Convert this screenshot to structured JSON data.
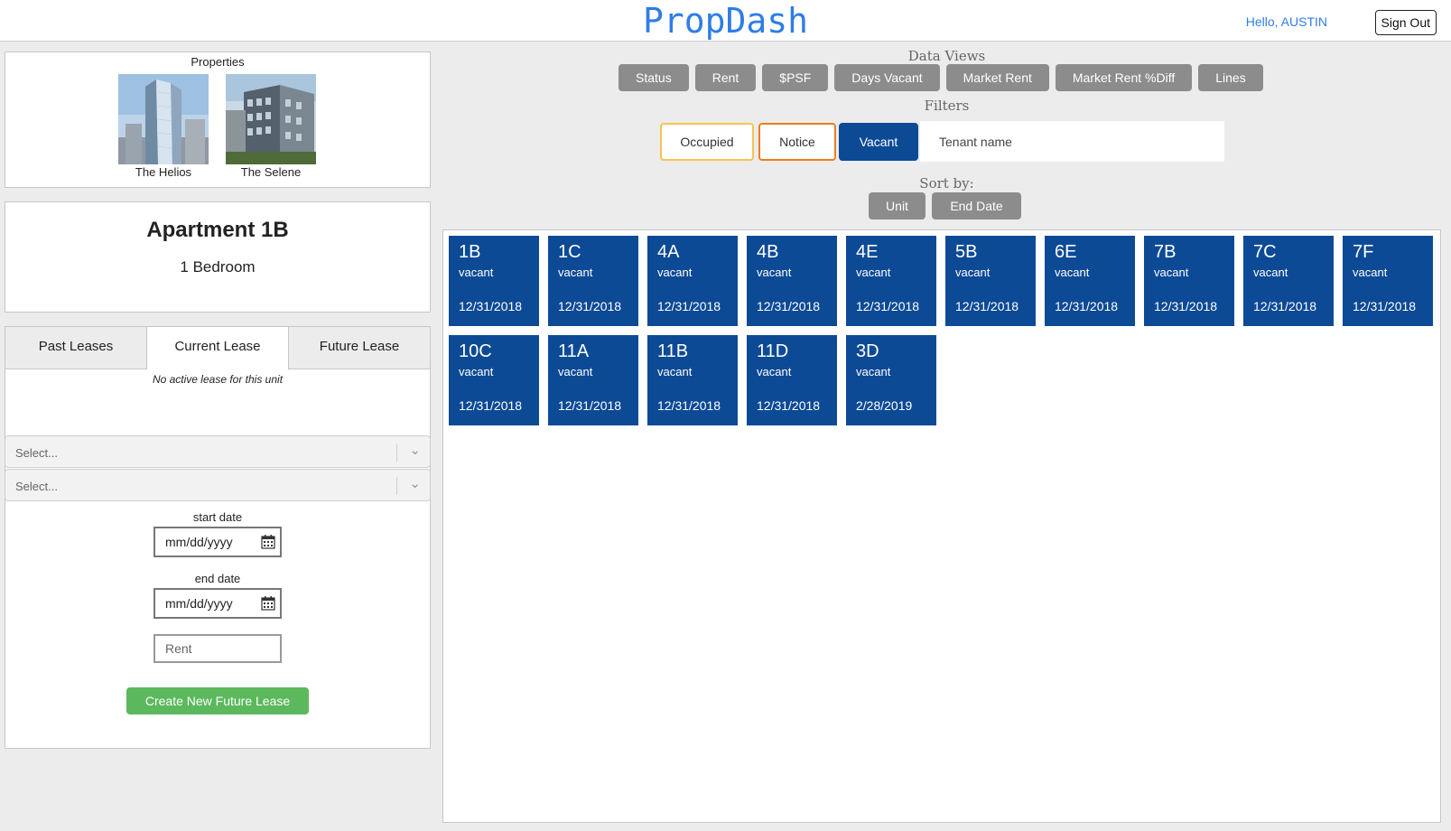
{
  "header": {
    "logo": "PropDash",
    "greeting": "Hello, AUSTIN",
    "signout_label": "Sign Out"
  },
  "properties": {
    "title": "Properties",
    "items": [
      {
        "name": "The Helios"
      },
      {
        "name": "The Selene"
      }
    ]
  },
  "apartment": {
    "title": "Apartment 1B",
    "subtitle": "1 Bedroom"
  },
  "lease": {
    "tabs": [
      {
        "label": "Past Leases"
      },
      {
        "label": "Current Lease",
        "active": true
      },
      {
        "label": "Future Lease"
      }
    ],
    "no_active_message": "No active lease for this unit",
    "select1_placeholder": "Select...",
    "select2_placeholder": "Select...",
    "start_label": "start date",
    "start_placeholder": "mm/dd/yyyy",
    "end_label": "end date",
    "end_placeholder": "mm/dd/yyyy",
    "rent_placeholder": "Rent",
    "create_label": "Create New Future Lease"
  },
  "data_views": {
    "title": "Data Views",
    "buttons": [
      "Status",
      "Rent",
      "$PSF",
      "Days Vacant",
      "Market Rent",
      "Market Rent %Diff",
      "Lines"
    ]
  },
  "filters": {
    "title": "Filters",
    "occupied_label": "Occupied",
    "notice_label": "Notice",
    "vacant_label": "Vacant",
    "tenant_placeholder": "Tenant name"
  },
  "sort": {
    "title": "Sort by:",
    "buttons": [
      "Unit",
      "End Date"
    ]
  },
  "units": [
    {
      "unit": "1B",
      "status": "vacant",
      "date": "12/31/2018"
    },
    {
      "unit": "1C",
      "status": "vacant",
      "date": "12/31/2018"
    },
    {
      "unit": "4A",
      "status": "vacant",
      "date": "12/31/2018"
    },
    {
      "unit": "4B",
      "status": "vacant",
      "date": "12/31/2018"
    },
    {
      "unit": "4E",
      "status": "vacant",
      "date": "12/31/2018"
    },
    {
      "unit": "5B",
      "status": "vacant",
      "date": "12/31/2018"
    },
    {
      "unit": "6E",
      "status": "vacant",
      "date": "12/31/2018"
    },
    {
      "unit": "7B",
      "status": "vacant",
      "date": "12/31/2018"
    },
    {
      "unit": "7C",
      "status": "vacant",
      "date": "12/31/2018"
    },
    {
      "unit": "7F",
      "status": "vacant",
      "date": "12/31/2018"
    },
    {
      "unit": "10C",
      "status": "vacant",
      "date": "12/31/2018"
    },
    {
      "unit": "11A",
      "status": "vacant",
      "date": "12/31/2018"
    },
    {
      "unit": "11B",
      "status": "vacant",
      "date": "12/31/2018"
    },
    {
      "unit": "11D",
      "status": "vacant",
      "date": "12/31/2018"
    },
    {
      "unit": "3D",
      "status": "vacant",
      "date": "2/28/2019"
    }
  ],
  "colors": {
    "brand_blue": "#2f7de6",
    "unit_blue": "#0d4a96",
    "button_gray": "#8c8c8c",
    "create_green": "#5cb85c",
    "occupied_border": "#f6c451",
    "notice_border": "#ef7d21"
  }
}
